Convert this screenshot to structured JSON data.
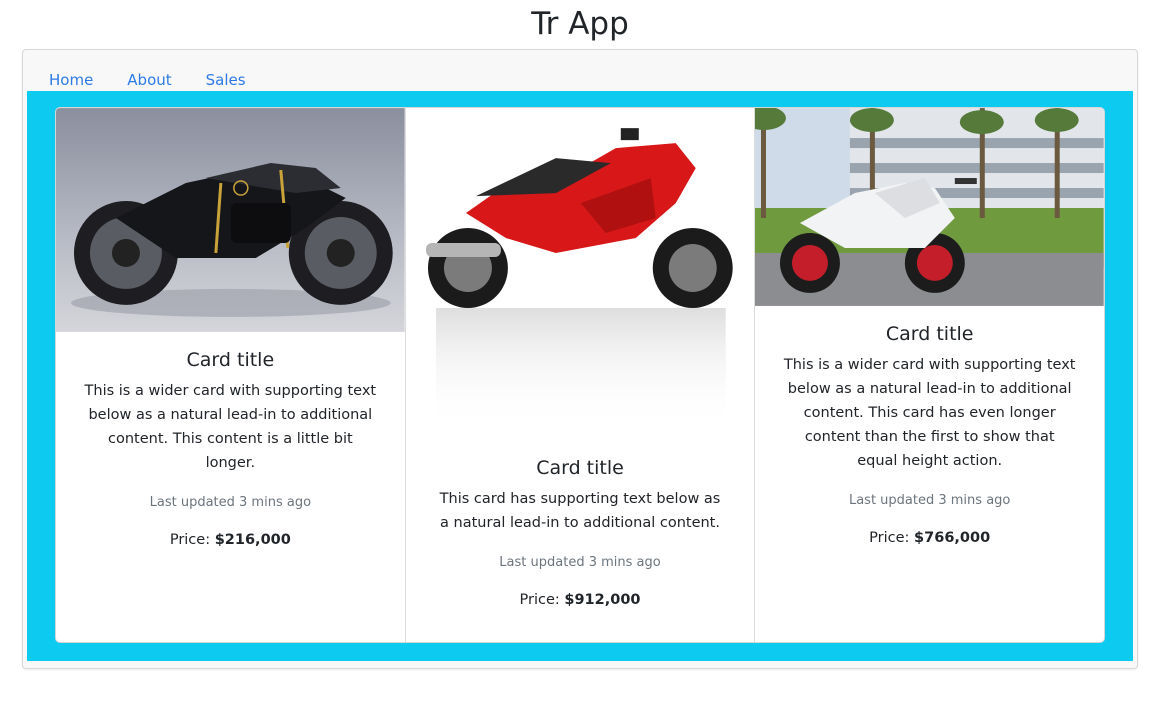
{
  "app": {
    "title": "Tr App"
  },
  "nav": {
    "items": [
      "Home",
      "About",
      "Sales"
    ]
  },
  "colors": {
    "accent": "#0dcaf0",
    "link": "#2c7be5"
  },
  "cards": [
    {
      "image": "black-lotus-motorcycle",
      "title": "Card title",
      "text": "This is a wider card with supporting text below as a natural lead-in to additional content. This content is a little bit longer.",
      "updated": "Last updated 3 mins ago",
      "price_label": "Price:",
      "price": "$216,000"
    },
    {
      "image": "red-sport-motorcycle",
      "title": "Card title",
      "text": "This card has supporting text below as a natural lead-in to additional content.",
      "updated": "Last updated 3 mins ago",
      "price_label": "Price:",
      "price": "$912,000"
    },
    {
      "image": "white-ducati-motorcycle",
      "title": "Card title",
      "text": "This is a wider card with supporting text below as a natural lead-in to additional content. This card has even longer content than the first to show that equal height action.",
      "updated": "Last updated 3 mins ago",
      "price_label": "Price:",
      "price": "$766,000"
    }
  ]
}
